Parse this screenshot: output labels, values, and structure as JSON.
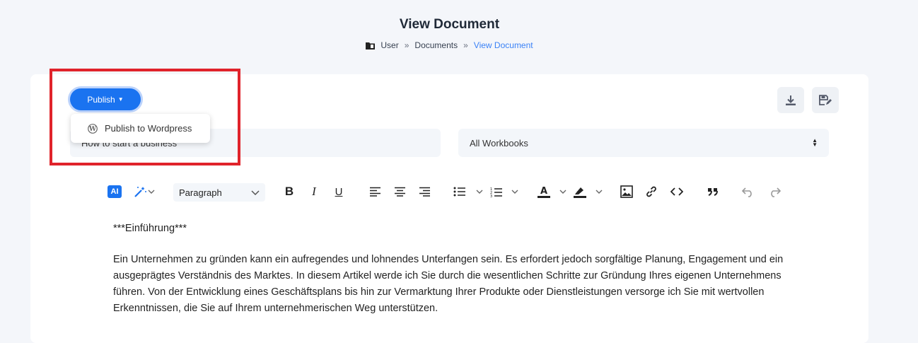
{
  "page": {
    "title": "View Document",
    "breadcrumb": [
      "User",
      "Documents",
      "View Document"
    ],
    "breadcrumb_separator": "»"
  },
  "publish": {
    "label": "Publish",
    "menu_items": [
      "Publish to Wordpress"
    ]
  },
  "form": {
    "title_value": "How to start a business",
    "workbook_value": "All Workbooks"
  },
  "toolbar": {
    "ai_label": "AI",
    "block_format": "Paragraph",
    "buttons": [
      "magic-wand",
      "bold",
      "italic",
      "underline",
      "align-left",
      "align-center",
      "align-right",
      "bulleted-list",
      "numbered-list",
      "text-color",
      "highlight",
      "image",
      "link",
      "code",
      "blockquote",
      "undo",
      "redo"
    ]
  },
  "document": {
    "heading": "***Einführung***",
    "paragraph": "Ein Unternehmen zu gründen kann ein aufregendes und lohnendes Unterfangen sein. Es erfordert jedoch sorgfältige Planung, Engagement und ein ausgeprägtes Verständnis des Marktes. In diesem Artikel werde ich Sie durch die wesentlichen Schritte zur Gründung Ihres eigenen Unternehmens führen. Von der Entwicklung eines Geschäftsplans bis hin zur Vermarktung Ihrer Produkte oder Dienstleistungen versorge ich Sie mit wertvollen Erkenntnissen, die Sie auf Ihrem unternehmerischen Weg unterstützen."
  },
  "colors": {
    "primary": "#1a73f0",
    "highlight_box": "#e0232b",
    "breadcrumb_active": "#3b82f6"
  }
}
